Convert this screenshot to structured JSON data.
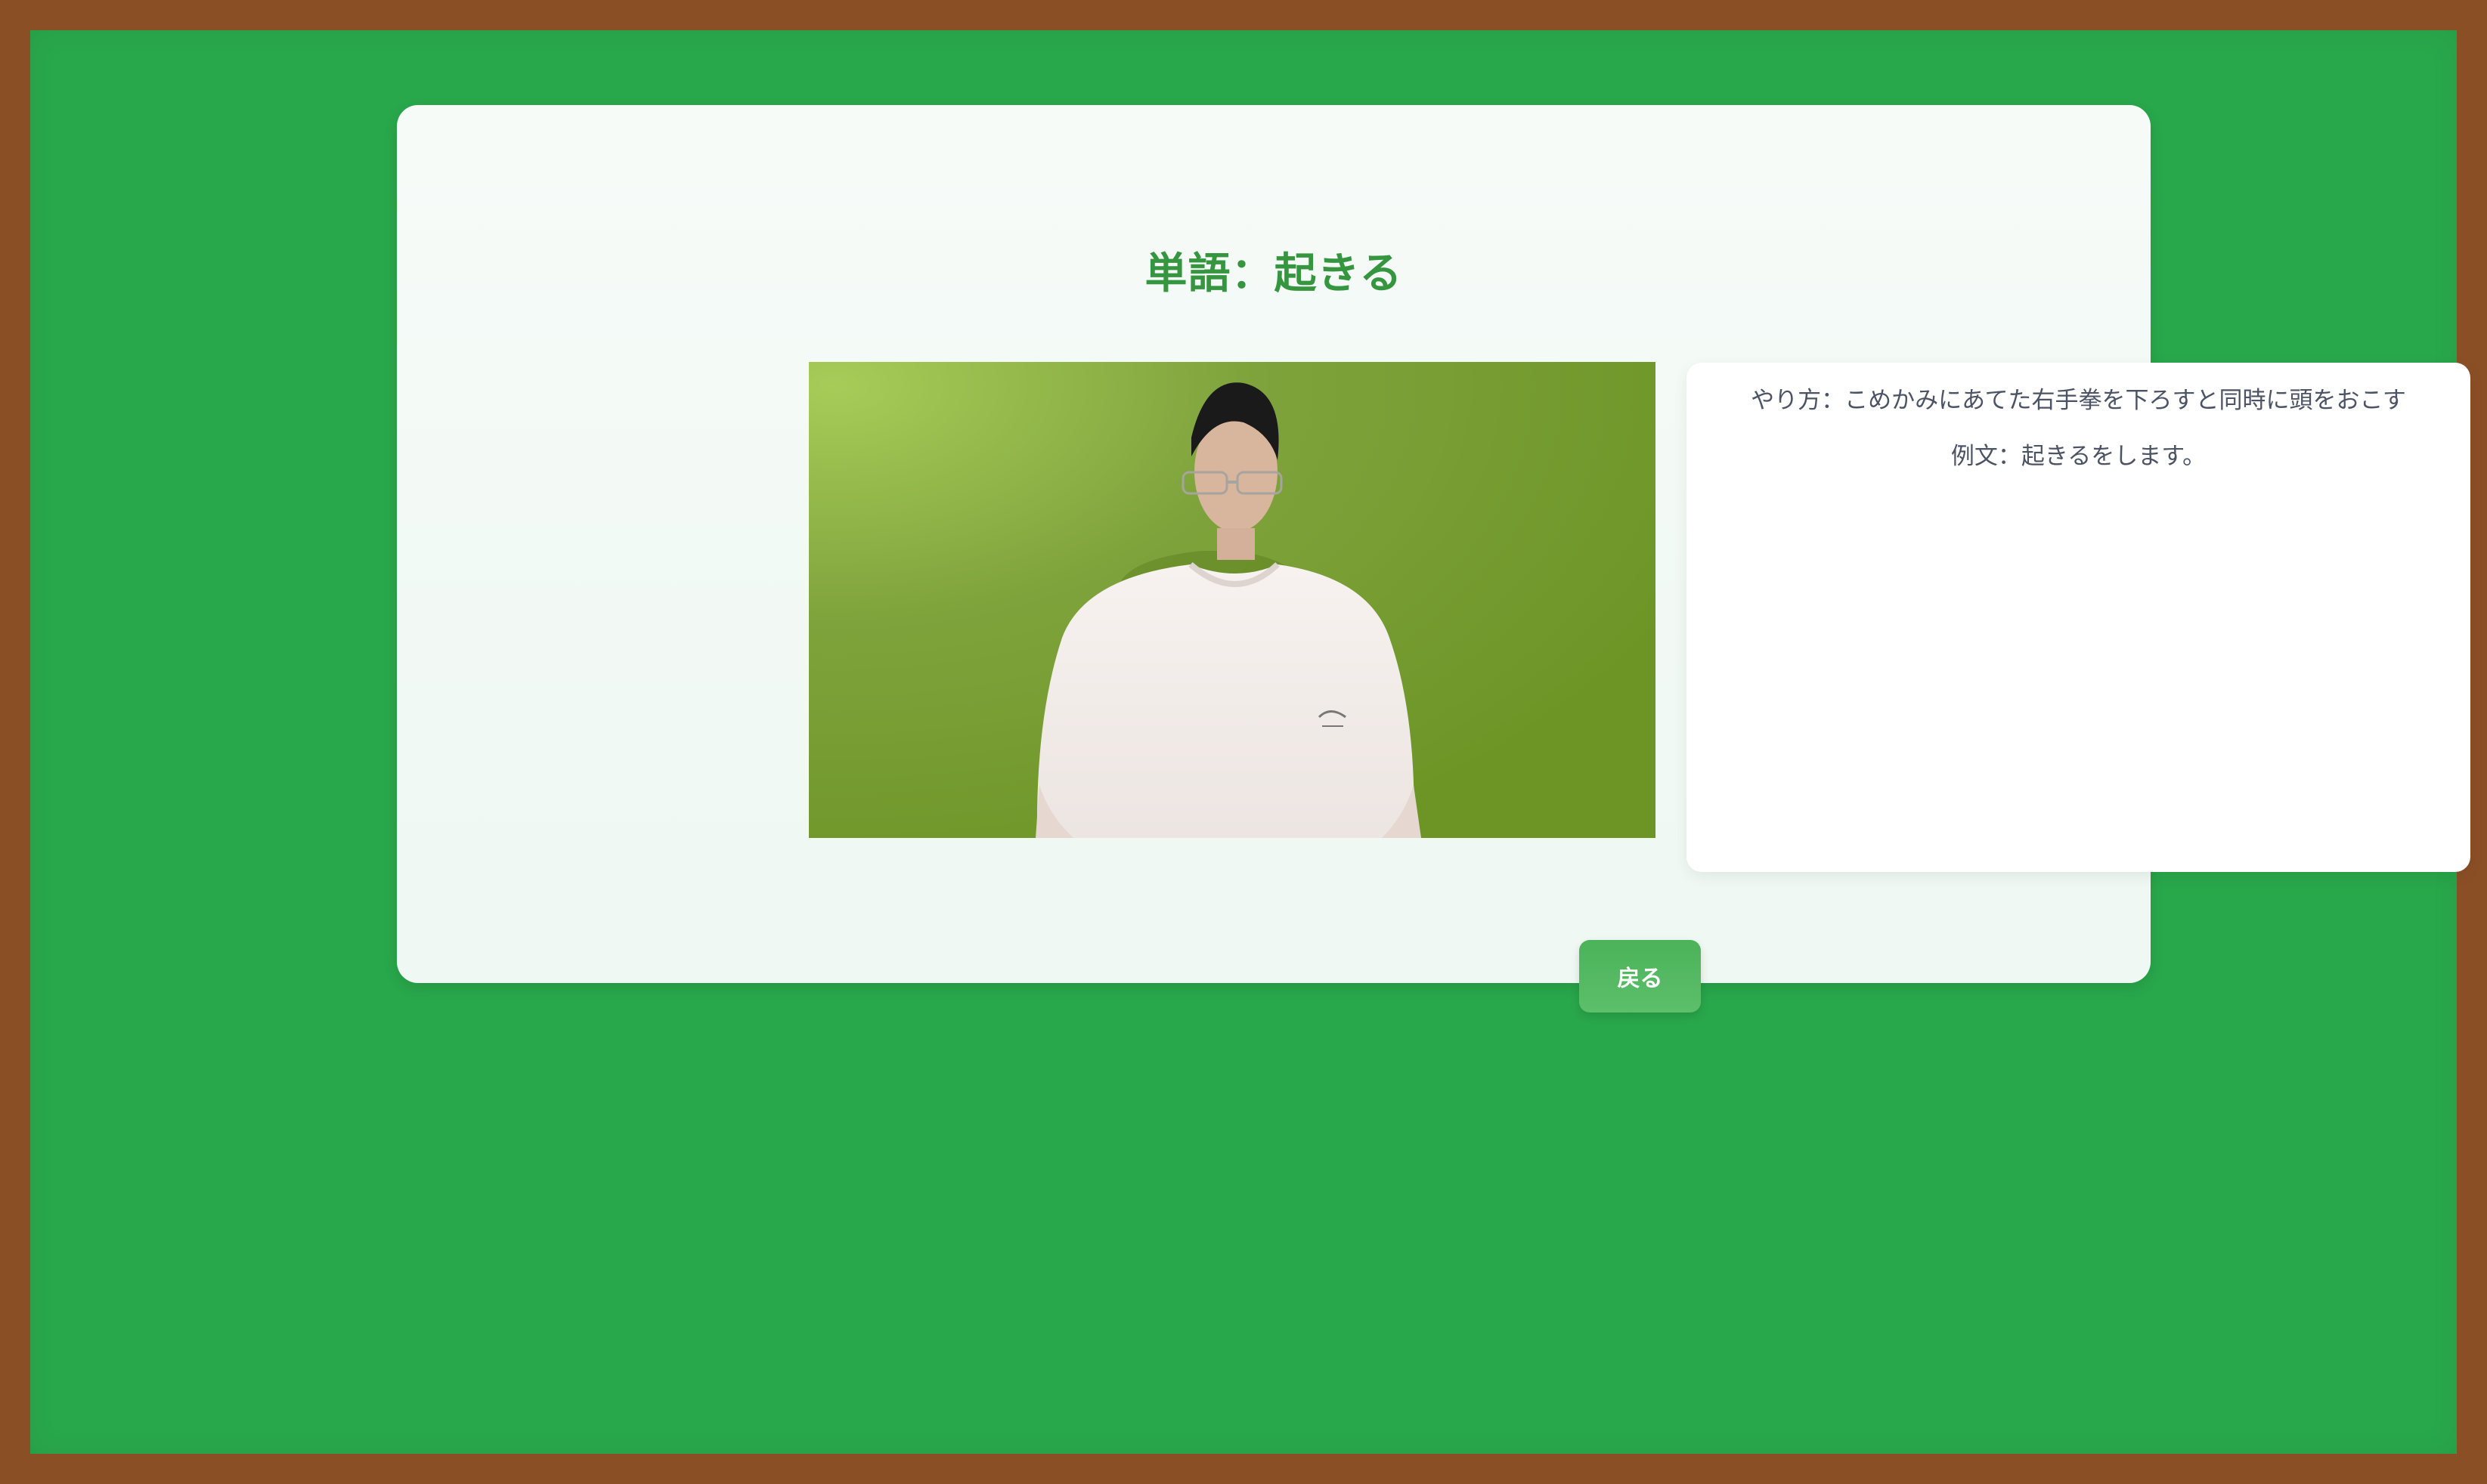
{
  "page": {
    "title": "単語：起きる"
  },
  "video": {
    "label": "sign-language video of 起きる"
  },
  "details": {
    "method": "やり方：こめかみにあてた右手拳を下ろすと同時に頭をおこす",
    "example": "例文：起きるをします。"
  },
  "actions": {
    "back_label": "戻る"
  },
  "colors": {
    "frame": "#8b4f26",
    "board": "#29a74b",
    "accent": "#36963f",
    "button": "#4cb35a"
  }
}
